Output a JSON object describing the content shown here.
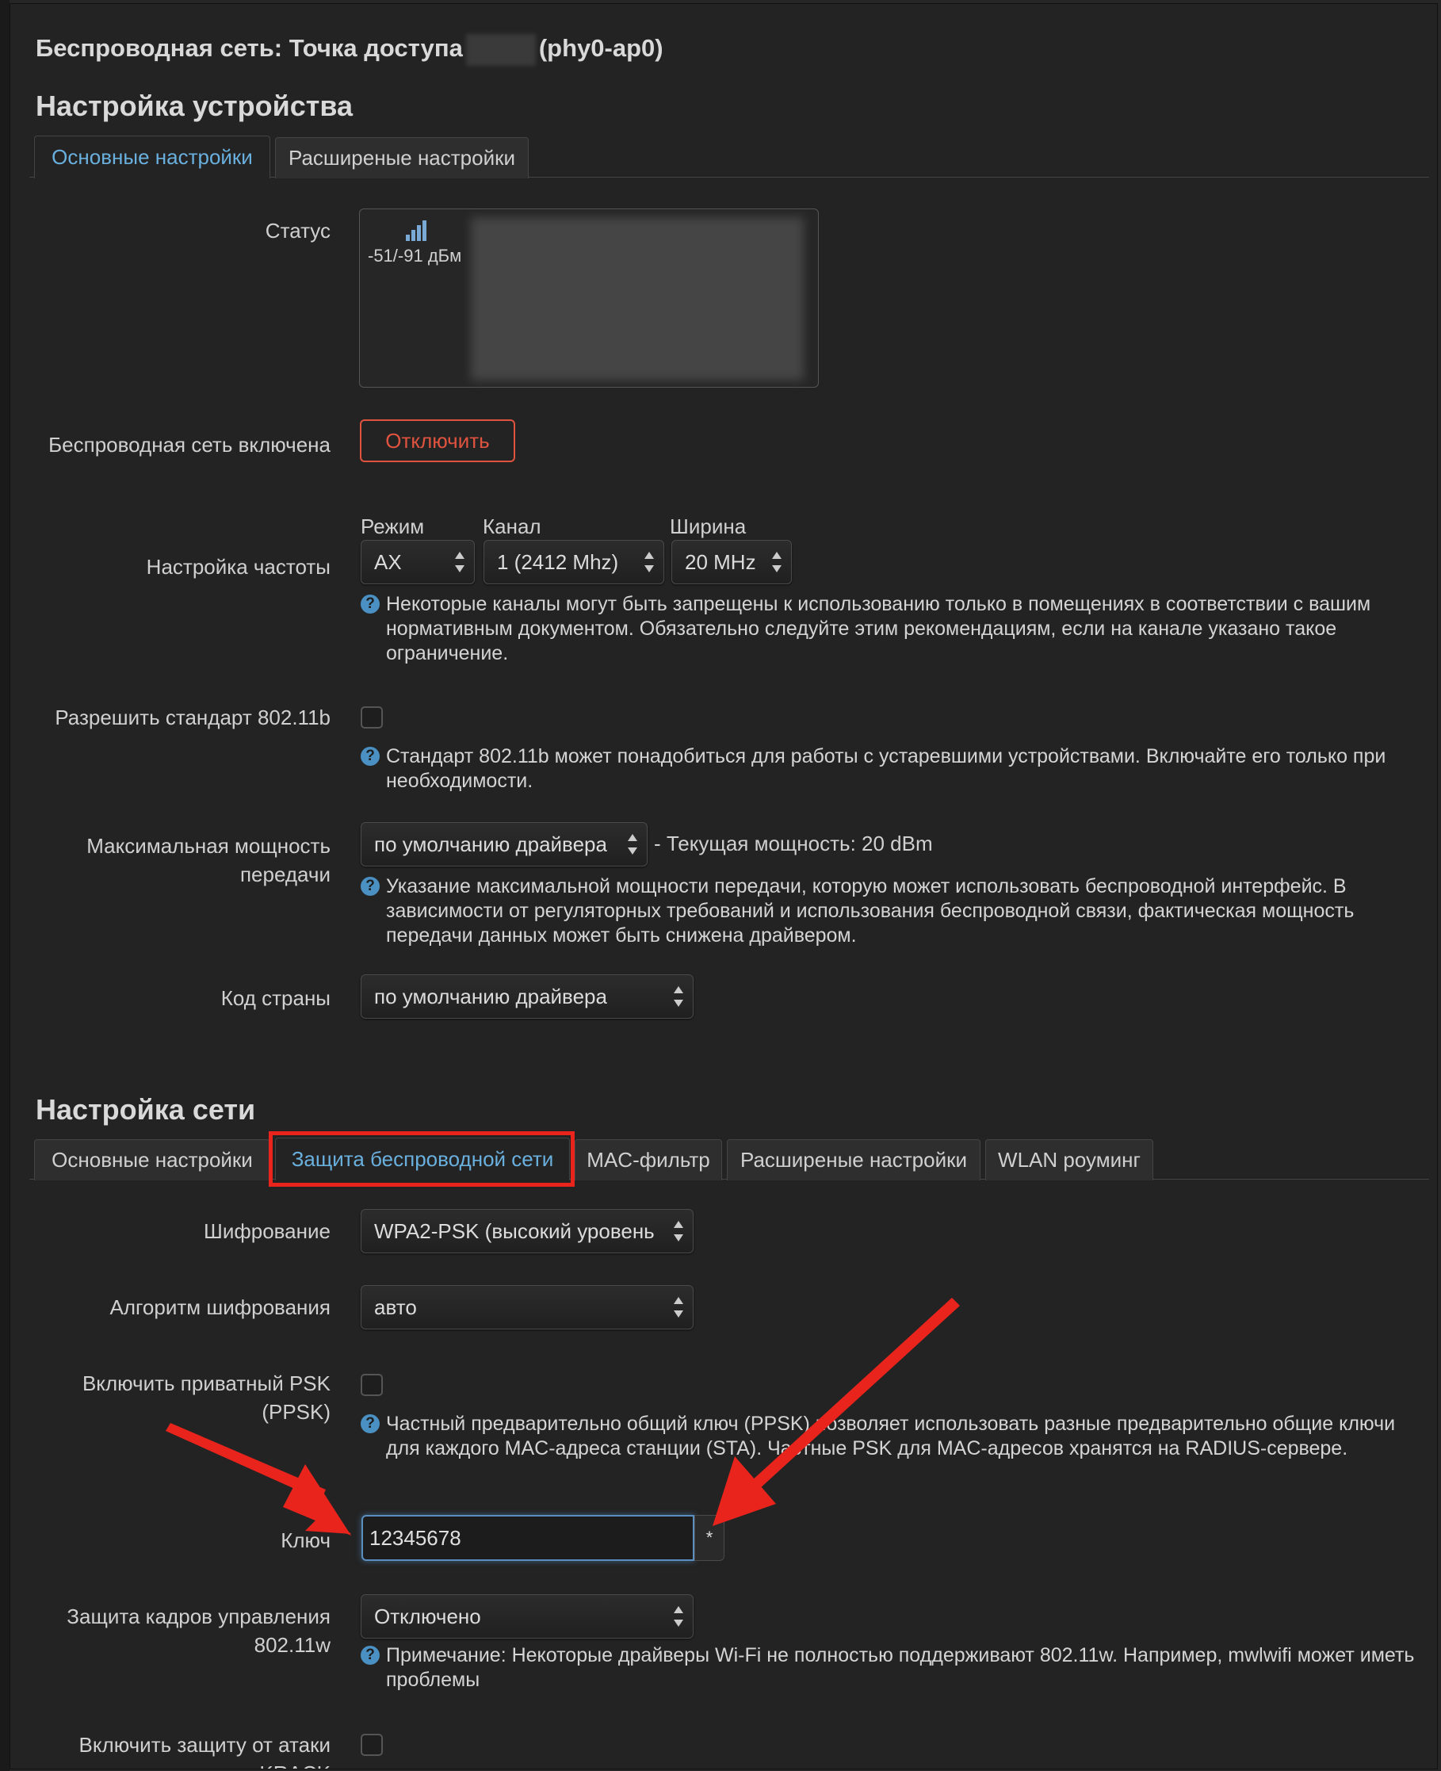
{
  "page": {
    "title": "Беспроводная сеть: Точка доступа",
    "title_suffix": "(phy0-ap0)"
  },
  "device": {
    "heading": "Настройка устройства",
    "tabs": [
      {
        "label": "Основные настройки",
        "active": true
      },
      {
        "label": "Расширеные настройки",
        "active": false
      }
    ],
    "status_label": "Статус",
    "signal": "-51/-91 дБм",
    "wireless_enabled_label": "Беспроводная сеть включена",
    "disable_button": "Отключить",
    "freq_label": "Настройка частоты",
    "mode_label": "Режим",
    "mode_value": "AX",
    "channel_label": "Канал",
    "channel_value": "1 (2412 Mhz)",
    "width_label": "Ширина",
    "width_value": "20 MHz",
    "freq_help": "Некоторые каналы могут быть запрещены к использованию только в помещениях в соответствии с вашим нормативным документом. Обязательно следуйте этим рекомендациям, если на канале указано такое ограничение.",
    "b_label": "Разрешить стандарт 802.11b",
    "b_help": "Стандарт 802.11b может понадобиться для работы с устаревшими устройствами. Включайте его только при необходимости.",
    "power_label": "Максимальная мощность передачи",
    "power_value": "по умолчанию драйвера",
    "power_current": "- Текущая мощность: 20 dBm",
    "power_help": "Указание максимальной мощности передачи, которую может использовать беспроводной интерфейс. В зависимости от регуляторных требований и использования беспроводной связи, фактическая мощность передачи данных может быть снижена драйвером.",
    "country_label": "Код страны",
    "country_value": "по умолчанию драйвера"
  },
  "network": {
    "heading": "Настройка сети",
    "tabs": [
      {
        "label": "Основные настройки",
        "active": false
      },
      {
        "label": "Защита беспроводной сети",
        "active": true
      },
      {
        "label": "MAC-фильтр",
        "active": false
      },
      {
        "label": "Расширеные настройки",
        "active": false
      },
      {
        "label": "WLAN роуминг",
        "active": false
      }
    ],
    "encryption_label": "Шифрование",
    "encryption_value": "WPA2-PSK (высокий уровень",
    "cipher_label": "Алгоритм шифрования",
    "cipher_value": "авто",
    "ppsk_label": "Включить приватный PSK (PPSK)",
    "ppsk_help": "Частный предварительно общий ключ (PPSK) позволяет использовать разные предварительно общие ключи для каждого MAC-адреса станции (STA). Частные PSK для MAC-адресов хранятся на RADIUS-сервере.",
    "key_label": "Ключ",
    "key_value": "12345678",
    "key_reveal": "*",
    "mfp_label": "Защита кадров управления 802.11w",
    "mfp_value": "Отключено",
    "mfp_help": "Примечание: Некоторые драйверы Wi-Fi не полностью поддерживают 802.11w. Например, mwlwifi может иметь проблемы",
    "krack_label": "Включить защиту от атаки KRACK"
  },
  "colors": {
    "accent": "#6ab0de",
    "danger": "#e0533f",
    "annotation": "#e8241c"
  }
}
